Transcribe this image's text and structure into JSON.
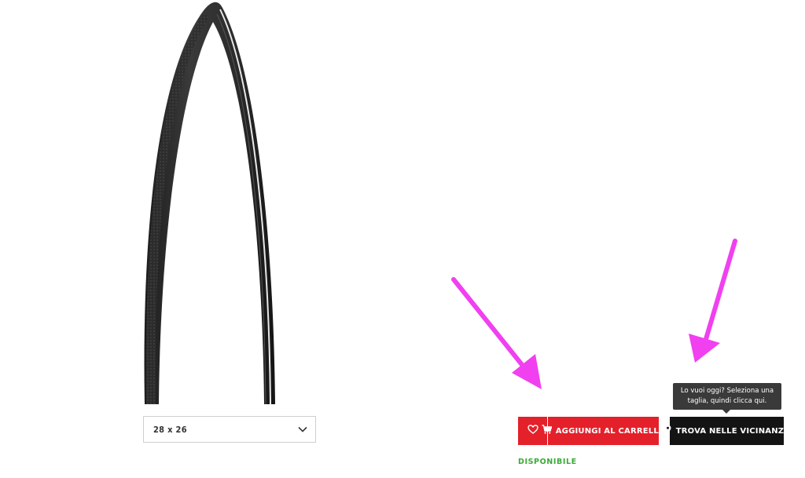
{
  "product": {
    "image_icon": "road-tire-image"
  },
  "size_select": {
    "value": "28 x 26",
    "icon": "chevron-down-icon"
  },
  "actions": {
    "wishlist_icon": "heart-icon",
    "cart_icon": "shopping-cart-icon",
    "cart_label": "AGGIUNGI AL CARRELLO",
    "nearby_icon": "map-pin-icon",
    "nearby_label": "TROVA NELLE VICINANZE"
  },
  "tooltip": {
    "line1": "Lo vuoi oggi? Seleziona una",
    "line2": "taglia, quindi clicca qui."
  },
  "status": {
    "availability": "DISPONIBILE"
  },
  "colors": {
    "primary_red": "#e4202a",
    "dark_button": "#141414",
    "available_green": "#3aaa35",
    "annotation_arrow": "#f040f0"
  }
}
